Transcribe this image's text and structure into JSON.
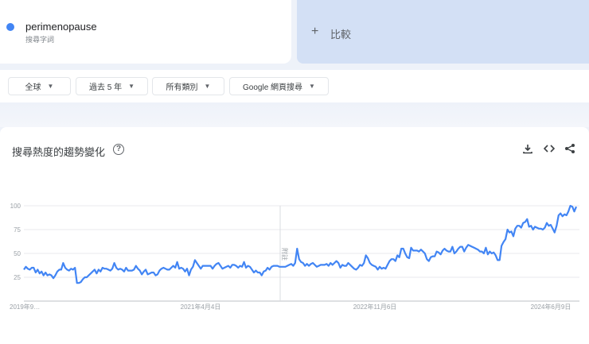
{
  "term": {
    "name": "perimenopause",
    "type": "搜尋字詞",
    "color": "#4285f4"
  },
  "compare": {
    "icon": "plus-icon",
    "label": "比較"
  },
  "filters": [
    {
      "label": "全球"
    },
    {
      "label": "過去 5 年"
    },
    {
      "label": "所有類別"
    },
    {
      "label": "Google 網頁搜尋"
    }
  ],
  "chart_header": {
    "title": "搜尋熱度的趨勢變化",
    "help": "?",
    "actions": [
      "download-icon",
      "embed-icon",
      "share-icon"
    ]
  },
  "chart_data": {
    "type": "line",
    "title": "搜尋熱度的趨勢變化",
    "series": [
      {
        "name": "perimenopause",
        "color": "#4285f4",
        "values": [
          33,
          36,
          34,
          33,
          35,
          35,
          30,
          33,
          29,
          31,
          27,
          30,
          27,
          28,
          27,
          24,
          27,
          31,
          33,
          33,
          40,
          35,
          33,
          32,
          34,
          33,
          35,
          19,
          19,
          20,
          23,
          25,
          25,
          27,
          29,
          31,
          33,
          29,
          33,
          31,
          35,
          34,
          34,
          33,
          32,
          34,
          40,
          35,
          33,
          34,
          33,
          31,
          35,
          32,
          32,
          32,
          33,
          37,
          34,
          32,
          28,
          31,
          33,
          28,
          29,
          30,
          30,
          27,
          28,
          32,
          34,
          35,
          34,
          33,
          33,
          35,
          37,
          35,
          41,
          34,
          35,
          34,
          31,
          34,
          27,
          33,
          36,
          43,
          40,
          37,
          34,
          37,
          37,
          37,
          37,
          37,
          34,
          37,
          39,
          40,
          37,
          34,
          35,
          36,
          37,
          35,
          38,
          38,
          37,
          35,
          37,
          36,
          41,
          35,
          37,
          36,
          33,
          30,
          32,
          30,
          30,
          27,
          31,
          32,
          35,
          33,
          36,
          37,
          37,
          37,
          36,
          36,
          36,
          36,
          37,
          38,
          39,
          37,
          40,
          55,
          44,
          41,
          40,
          37,
          39,
          37,
          39,
          40,
          38,
          36,
          37,
          38,
          38,
          38,
          39,
          37,
          40,
          38,
          40,
          42,
          40,
          35,
          38,
          37,
          37,
          40,
          38,
          36,
          34,
          33,
          35,
          38,
          37,
          40,
          48,
          45,
          40,
          38,
          37,
          36,
          33,
          36,
          34,
          35,
          34,
          38,
          42,
          44,
          44,
          42,
          48,
          46,
          55,
          55,
          50,
          46,
          45,
          56,
          53,
          53,
          53,
          52,
          54,
          52,
          50,
          44,
          42,
          46,
          47,
          47,
          52,
          51,
          49,
          53,
          55,
          53,
          52,
          52,
          57,
          50,
          52,
          55,
          57,
          57,
          52,
          56,
          59,
          58,
          57,
          56,
          55,
          54,
          52,
          52,
          50,
          56,
          49,
          52,
          50,
          51,
          48,
          43,
          43,
          58,
          62,
          65,
          75,
          72,
          73,
          68,
          76,
          79,
          79,
          77,
          82,
          83,
          86,
          78,
          79,
          75,
          78,
          77,
          76,
          76,
          75,
          77,
          82,
          79,
          80,
          76,
          72,
          79,
          90,
          92,
          89,
          91,
          90,
          94,
          100,
          99,
          94,
          99
        ]
      }
    ],
    "yticks": [
      100,
      75,
      50,
      25
    ],
    "ylim": [
      0,
      100
    ],
    "xtick_labels": [
      "2019年9…",
      "2021年4月4日",
      "2022年11月6日",
      "2024年6月9日"
    ],
    "annotation": "附註",
    "grid": true
  }
}
